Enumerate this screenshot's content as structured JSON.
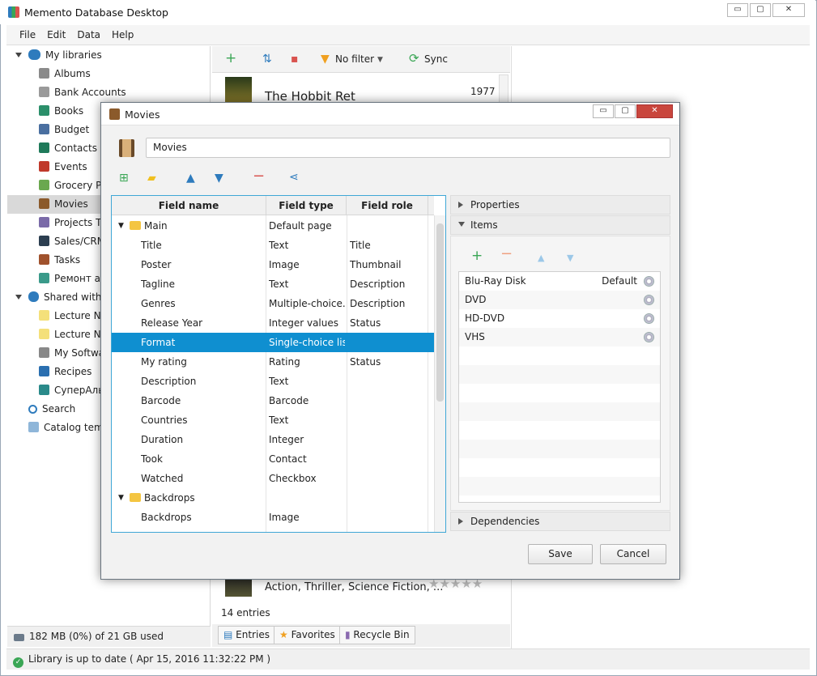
{
  "app": {
    "title": "Memento Database Desktop",
    "window_buttons": [
      "▭",
      "▢",
      "✕"
    ]
  },
  "menu": [
    "File",
    "Edit",
    "Data",
    "Help"
  ],
  "sidebar": {
    "root_label": "My libraries",
    "items": [
      {
        "label": "Albums",
        "color": "#8a8a8a"
      },
      {
        "label": "Bank Accounts",
        "color": "#9a9a9a"
      },
      {
        "label": "Books",
        "color": "#2b8f6a"
      },
      {
        "label": "Budget",
        "color": "#4a6fa0"
      },
      {
        "label": "Contacts",
        "color": "#1f7a5a"
      },
      {
        "label": "Events",
        "color": "#c0392b"
      },
      {
        "label": "Grocery Pr",
        "color": "#6aa84f"
      },
      {
        "label": "Movies",
        "color": "#8b5a2b"
      },
      {
        "label": "Projects To",
        "color": "#7a6aa8"
      },
      {
        "label": "Sales/CRM",
        "color": "#2c3e50"
      },
      {
        "label": "Tasks",
        "color": "#a0522d"
      },
      {
        "label": "Ремонт ав",
        "color": "#3a9a8a"
      }
    ],
    "shared_label": "Shared with u",
    "shared_items": [
      {
        "label": "Lecture No",
        "color": "#f4e07a"
      },
      {
        "label": "Lecture No",
        "color": "#f4e07a"
      },
      {
        "label": "My Softwa",
        "color": "#888888"
      },
      {
        "label": "Recipes",
        "color": "#2a6fb0"
      },
      {
        "label": "СуперАлы",
        "color": "#2a8a8a"
      }
    ],
    "search_label": "Search",
    "catalog_label": "Catalog temp",
    "storage": "182 MB (0%) of 21 GB used"
  },
  "status": "Library is up to date ( Apr 15, 2016 11:32:22 PM )",
  "library_view": {
    "toolbar": {
      "filter": "No filter",
      "sync": "Sync"
    },
    "entry_top": {
      "title": "The Hobbit Ret",
      "year": "1977"
    },
    "entry_bottom": {
      "subtitle": "Action, Thriller, Science Fiction, ..."
    },
    "entries_count": "14 entries",
    "tabs": [
      "Entries",
      "Favorites",
      "Recycle Bin"
    ]
  },
  "dialog": {
    "title": "Movies",
    "name_value": "Movies",
    "columns": [
      "Field name",
      "Field type",
      "Field role"
    ],
    "rows": [
      {
        "kind": "group",
        "name": "Main",
        "type": "Default page",
        "role": ""
      },
      {
        "kind": "field",
        "name": "Title",
        "type": "Text",
        "role": "Title"
      },
      {
        "kind": "field",
        "name": "Poster",
        "type": "Image",
        "role": "Thumbnail"
      },
      {
        "kind": "field",
        "name": "Tagline",
        "type": "Text",
        "role": "Description"
      },
      {
        "kind": "field",
        "name": "Genres",
        "type": "Multiple-choice...",
        "role": "Description"
      },
      {
        "kind": "field",
        "name": "Release Year",
        "type": "Integer values",
        "role": "Status"
      },
      {
        "kind": "field",
        "name": "Format",
        "type": "Single-choice list",
        "role": "",
        "selected": true
      },
      {
        "kind": "field",
        "name": "My rating",
        "type": "Rating",
        "role": "Status"
      },
      {
        "kind": "field",
        "name": "Description",
        "type": "Text",
        "role": ""
      },
      {
        "kind": "field",
        "name": "Barcode",
        "type": "Barcode",
        "role": ""
      },
      {
        "kind": "field",
        "name": "Countries",
        "type": "Text",
        "role": ""
      },
      {
        "kind": "field",
        "name": "Duration",
        "type": "Integer",
        "role": ""
      },
      {
        "kind": "field",
        "name": "Took",
        "type": "Contact",
        "role": ""
      },
      {
        "kind": "field",
        "name": "Watched",
        "type": "Checkbox",
        "role": ""
      },
      {
        "kind": "group",
        "name": "Backdrops",
        "type": "",
        "role": ""
      },
      {
        "kind": "field",
        "name": "Backdrops",
        "type": "Image",
        "role": ""
      }
    ],
    "properties_label": "Properties",
    "items_label": "Items",
    "items": [
      {
        "label": "Blu-Ray Disk",
        "badge": "Default"
      },
      {
        "label": "DVD",
        "badge": ""
      },
      {
        "label": "HD-DVD",
        "badge": ""
      },
      {
        "label": "VHS",
        "badge": ""
      }
    ],
    "dependencies_label": "Dependencies",
    "save_label": "Save",
    "cancel_label": "Cancel"
  }
}
